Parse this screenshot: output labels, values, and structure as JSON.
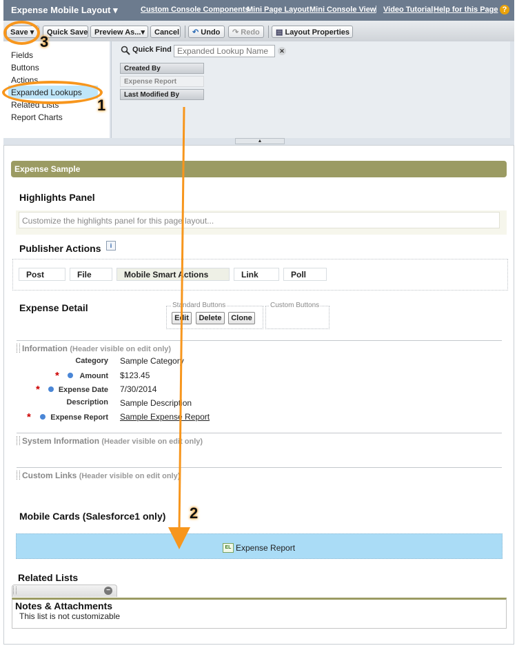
{
  "header": {
    "layout_title": "Expense Mobile Layout",
    "links": [
      "Custom Console Components",
      "Mini Page Layout",
      "Mini Console View",
      "Video Tutorial",
      "Help for this Page"
    ],
    "separator": "|",
    "help_glyph": "?"
  },
  "toolbar": {
    "save": "Save",
    "quick_save": "Quick Save",
    "preview_as": "Preview As...",
    "cancel": "Cancel",
    "undo": "Undo",
    "redo": "Redo",
    "layout_properties": "Layout Properties"
  },
  "palette": {
    "categories": [
      "Fields",
      "Buttons",
      "Actions",
      "Expanded Lookups",
      "Related Lists",
      "Report Charts"
    ],
    "selected_category": "Expanded Lookups",
    "quick_find_label": "Quick Find",
    "quick_find_placeholder": "Expanded Lookup Name",
    "items": [
      {
        "label": "Created By",
        "state": "available"
      },
      {
        "label": "Expense Report",
        "state": "used"
      },
      {
        "label": "Last Modified By",
        "state": "available"
      }
    ]
  },
  "layout": {
    "section_bar": "Expense Sample",
    "highlights": {
      "title": "Highlights Panel",
      "placeholder": "Customize the highlights panel for this page layout..."
    },
    "publisher": {
      "title": "Publisher Actions",
      "info_glyph": "i",
      "actions": [
        "Post",
        "File",
        "Mobile Smart Actions",
        "Link",
        "Poll"
      ]
    },
    "detail": {
      "title": "Expense Detail",
      "standard_buttons_label": "Standard Buttons",
      "custom_buttons_label": "Custom Buttons",
      "standard_buttons": [
        "Edit",
        "Delete",
        "Clone"
      ]
    },
    "information": {
      "title": "Information",
      "note": "(Header visible on edit only)",
      "fields": [
        {
          "label": "Category",
          "value": "Sample Category",
          "required": false
        },
        {
          "label": "Amount",
          "value": "$123.45",
          "required": true
        },
        {
          "label": "Expense Date",
          "value": "7/30/2014",
          "required": true
        },
        {
          "label": "Description",
          "value": "Sample Description",
          "required": false
        },
        {
          "label": "Expense Report",
          "value": "Sample Expense Report",
          "required": true
        }
      ],
      "required_mark": "*"
    },
    "system_information": {
      "title": "System Information",
      "note": "(Header visible on edit only)"
    },
    "custom_links": {
      "title": "Custom Links",
      "note": "(Header visible on edit only)"
    },
    "mobile_cards": {
      "title": "Mobile Cards (Salesforce1 only)",
      "card_icon_text": "EL",
      "card_label": "Expense Report"
    },
    "related_lists": {
      "title": "Related Lists",
      "remove_glyph": "−",
      "notes_title": "Notes & Attachments",
      "notes_sub": "This list is not customizable"
    }
  },
  "annotations": {
    "numbers": [
      "1",
      "2",
      "3"
    ],
    "color": "#f7961d"
  }
}
